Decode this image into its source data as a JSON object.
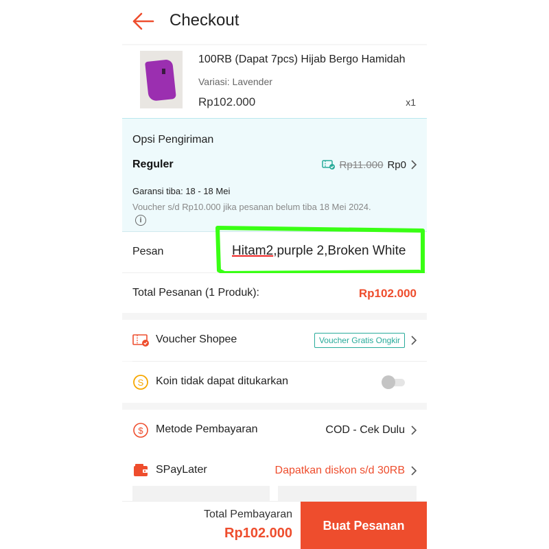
{
  "header": {
    "title": "Checkout"
  },
  "product": {
    "name": "100RB (Dapat 7pcs) Hijab Bergo Hamidah",
    "variant": "Variasi: Lavender",
    "price": "Rp102.000",
    "quantity": "x1"
  },
  "shipping": {
    "title": "Opsi Pengiriman",
    "type": "Reguler",
    "old_price": "Rp11.000",
    "new_price": "Rp0",
    "guarantee": "Garansi tiba: 18 - 18 Mei",
    "voucher_note": "Voucher s/d  Rp10.000 jika pesanan belum tiba 18 Mei 2024."
  },
  "message": {
    "label": "Pesan",
    "value_part1": "Hitam2",
    "value_part2": ",purple 2,Broken White"
  },
  "order_total": {
    "label": "Total Pesanan (1 Produk):",
    "value": "Rp102.000"
  },
  "voucher": {
    "label": "Voucher Shopee",
    "badge": "Voucher Gratis Ongkir"
  },
  "coins": {
    "label": "Koin tidak dapat ditukarkan",
    "enabled": false
  },
  "payment": {
    "label": "Metode Pembayaran",
    "value": "COD - Cek Dulu"
  },
  "spaylater": {
    "label": "SPayLater",
    "value": "Dapatkan diskon s/d 30RB"
  },
  "footer": {
    "total_label": "Total Pembayaran",
    "total_value": "Rp102.000",
    "order_button": "Buat Pesanan"
  },
  "colors": {
    "accent": "#ee4d2d",
    "teal": "#26aa99",
    "highlight_marker": "#39ff14"
  }
}
